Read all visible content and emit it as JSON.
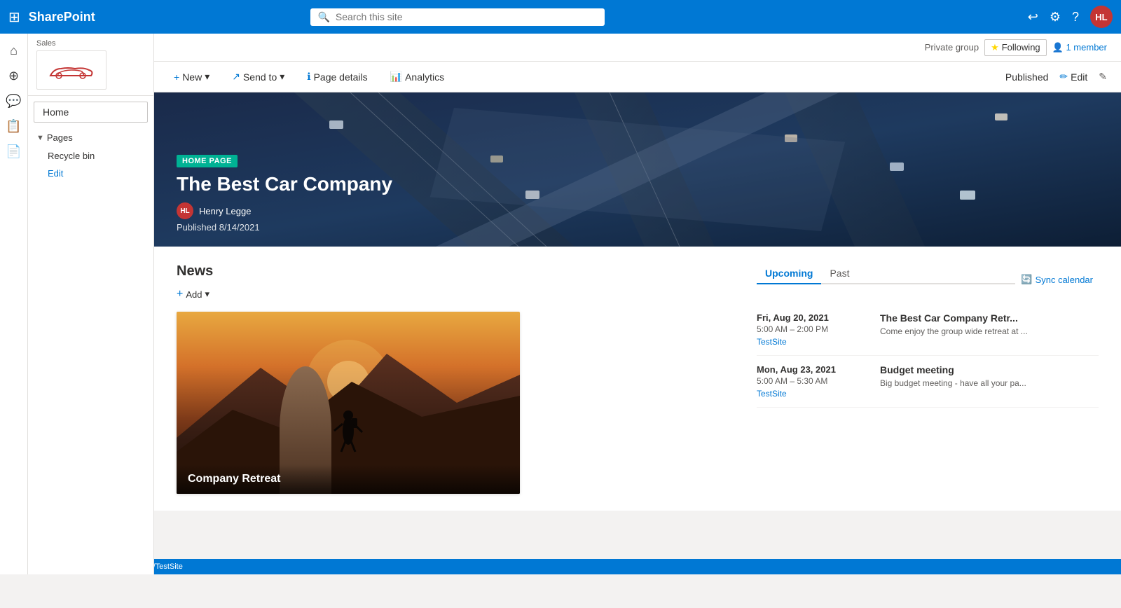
{
  "topbar": {
    "waffle_label": "⊞",
    "brand": "SharePoint",
    "search_placeholder": "Search this site",
    "settings_icon": "⚙",
    "help_icon": "?",
    "user_initials": "HL"
  },
  "left_icons": [
    {
      "name": "home-icon",
      "icon": "⌂"
    },
    {
      "name": "add-icon",
      "icon": "+"
    },
    {
      "name": "chat-icon",
      "icon": "💬"
    },
    {
      "name": "notes-icon",
      "icon": "📋"
    },
    {
      "name": "pages-icon",
      "icon": "📄"
    }
  ],
  "sidebar": {
    "site_name": "Sales",
    "home_label": "Home",
    "pages_section": "Pages",
    "recycle_bin": "Recycle bin",
    "edit_label": "Edit"
  },
  "site_header": {
    "private_group": "Private group",
    "following_label": "Following",
    "members_label": "1 member"
  },
  "page_actions": {
    "new_label": "New",
    "send_to_label": "Send to",
    "page_details_label": "Page details",
    "analytics_label": "Analytics",
    "published_label": "Published",
    "edit_label": "Edit"
  },
  "hero": {
    "badge": "HOME PAGE",
    "title": "The Best Car Company",
    "author_initials": "HL",
    "author_name": "Henry Legge",
    "published": "Published 8/14/2021"
  },
  "news": {
    "title": "News",
    "add_label": "Add",
    "card": {
      "title": "Company Retreat",
      "image_alt": "company retreat image"
    }
  },
  "events": {
    "upcoming_tab": "Upcoming",
    "past_tab": "Past",
    "sync_label": "Sync calendar",
    "items": [
      {
        "date": "Fri, Aug 20, 2021",
        "time": "5:00 AM – 2:00 PM",
        "site": "TestSite",
        "title": "The Best Car Company Retr...",
        "desc": "Come enjoy the group wide retreat at ..."
      },
      {
        "date": "Mon, Aug 23, 2021",
        "time": "5:00 AM – 5:30 AM",
        "site": "TestSite",
        "title": "Budget meeting",
        "desc": "Big budget meeting - have all your pa..."
      }
    ]
  },
  "statusbar": {
    "url": "https://citizenbuilders.sharepoint.com/sites/TestSite"
  }
}
